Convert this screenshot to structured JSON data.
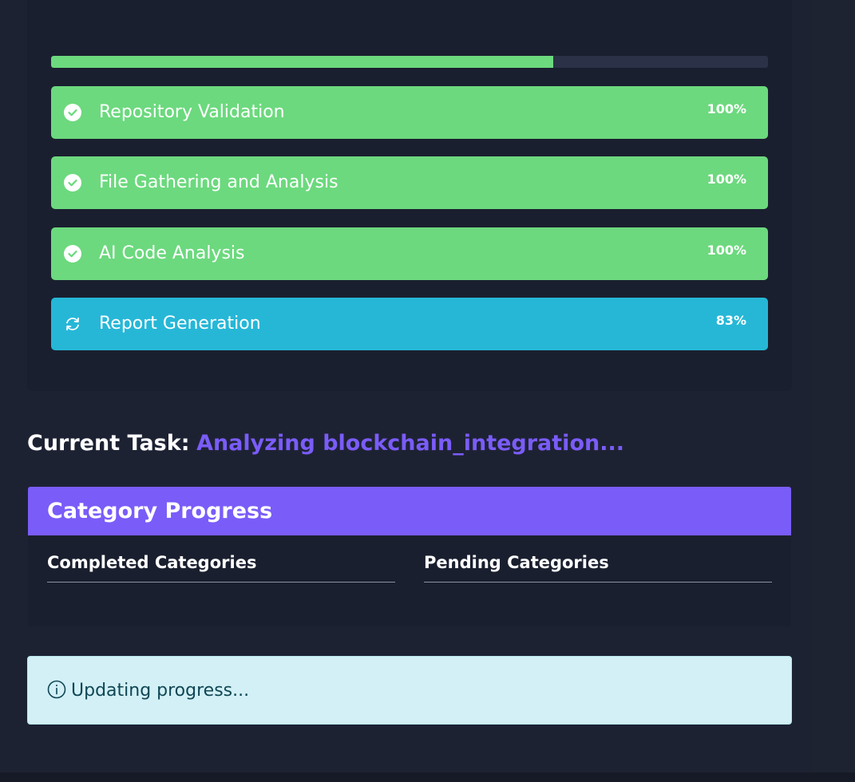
{
  "progress": {
    "overall_fraction": 0.7,
    "steps": [
      {
        "label": "Repository Validation",
        "percent": "100%",
        "status": "done",
        "icon": "check-circle-icon"
      },
      {
        "label": "File Gathering and Analysis",
        "percent": "100%",
        "status": "done",
        "icon": "check-circle-icon"
      },
      {
        "label": "AI Code Analysis",
        "percent": "100%",
        "status": "done",
        "icon": "check-circle-icon"
      },
      {
        "label": "Report Generation",
        "percent": "83%",
        "status": "running",
        "icon": "refresh-icon"
      }
    ]
  },
  "current_task": {
    "label": "Current Task:",
    "value": "Analyzing blockchain_integration..."
  },
  "category_progress": {
    "title": "Category Progress",
    "completed_title": "Completed Categories",
    "pending_title": "Pending Categories"
  },
  "alert": {
    "icon": "info-icon",
    "text": "Updating progress..."
  },
  "colors": {
    "done": "#6cd97e",
    "running": "#26b7d7",
    "accent": "#7a5cf8",
    "background": "#1d2233",
    "alert_bg": "#d2f0f6"
  }
}
